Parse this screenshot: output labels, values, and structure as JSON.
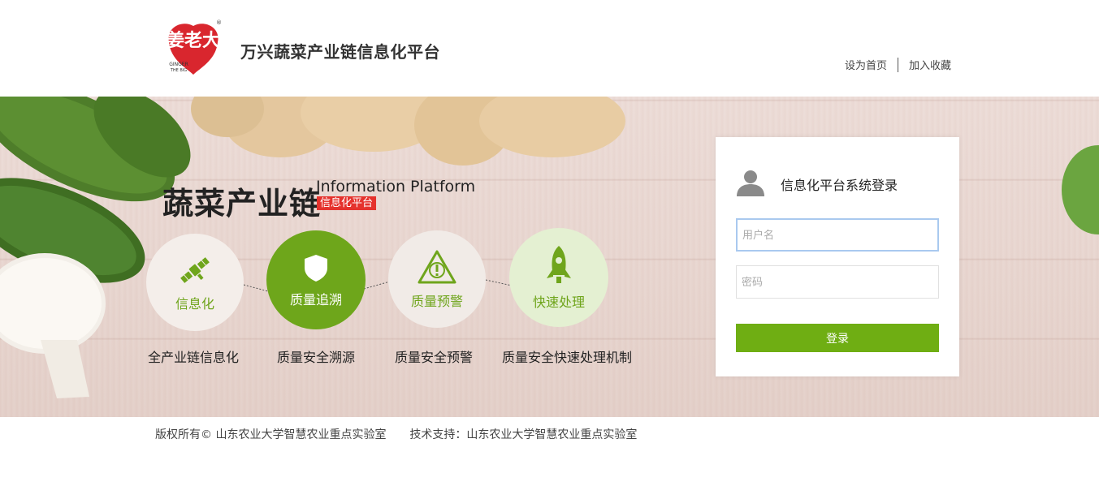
{
  "header": {
    "logo_text_cn": "姜老大",
    "logo_text_en_1": "GINGER",
    "logo_text_en_2": "THE BIG",
    "site_title": "万兴蔬菜产业链信息化平台",
    "link_home": "设为首页",
    "link_favorite": "加入收藏"
  },
  "banner": {
    "big_title": "蔬菜产业链",
    "en_title": "Information Platform",
    "cn_badge": "信息化平台",
    "features": [
      {
        "label": "信息化",
        "caption": "全产业链信息化",
        "icon": "satellite-icon"
      },
      {
        "label": "质量追溯",
        "caption": "质量安全溯源",
        "icon": "shield-icon"
      },
      {
        "label": "质量预警",
        "caption": "质量安全预警",
        "icon": "warning-icon"
      },
      {
        "label": "快速处理",
        "caption": "质量安全快速处理机制",
        "icon": "rocket-icon"
      }
    ]
  },
  "login": {
    "title": "信息化平台系统登录",
    "username_placeholder": "用户名",
    "password_placeholder": "密码",
    "submit_label": "登录"
  },
  "footer": {
    "copyright": "版权所有© 山东农业大学智慧农业重点实验室",
    "support": "技术支持：山东农业大学智慧农业重点实验室"
  },
  "colors": {
    "accent_green": "#6ea61b",
    "badge_red": "#e5322d",
    "logo_red": "#d9262e"
  }
}
